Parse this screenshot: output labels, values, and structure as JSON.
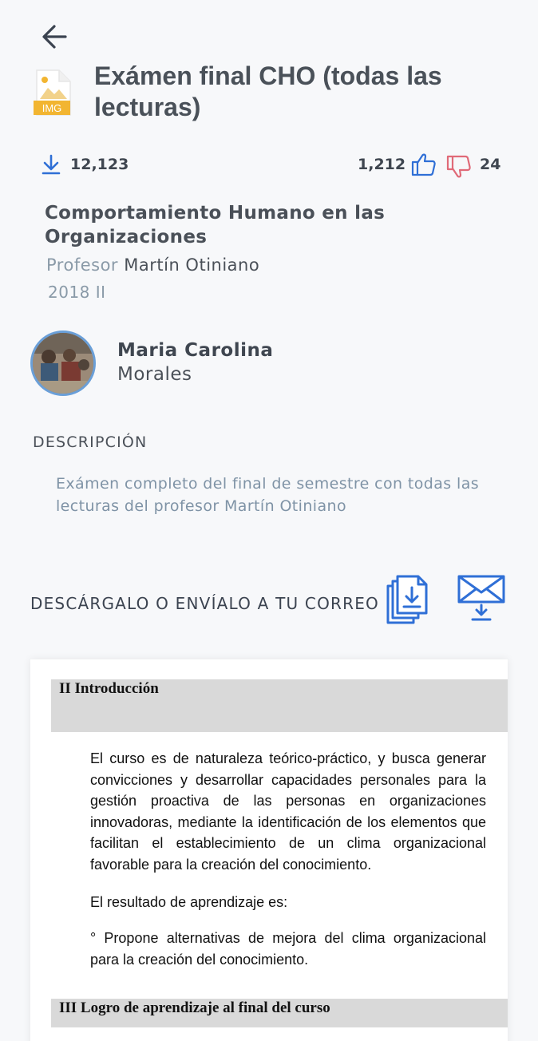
{
  "header": {
    "title": "Exámen final CHO (todas las lecturas)",
    "file_type": "IMG"
  },
  "stats": {
    "downloads": "12,123",
    "likes": "1,212",
    "dislikes": "24"
  },
  "course": {
    "name": "Comportamiento Humano en las Organizaciones",
    "professor_label": "Profesor",
    "professor_name": "Martín Otiniano",
    "term": "2018 II"
  },
  "author": {
    "first_name": "Maria Carolina",
    "last_name": "Morales"
  },
  "description": {
    "heading": "DESCRIPCIÓN",
    "text": "Exámen completo del final de semestre con todas las lecturas del profesor Martín Otiniano"
  },
  "actions": {
    "label": "DESCÁRGALO O ENVÍALO A TU CORREO",
    "download_icon": "document-download-icon",
    "email_icon": "email-download-icon"
  },
  "preview": {
    "section1_title": "II  Introducción",
    "paragraph1": "El curso es de naturaleza teórico-práctico, y busca generar convicciones y desarrollar capacidades personales para la gestión proactiva de las personas en organizaciones innovadoras, mediante la identificación de los elementos que facilitan el establecimiento de un clima organizacional favorable para la creación del conocimiento.",
    "paragraph2": "El resultado de aprendizaje es:",
    "paragraph3": "° Propone alternativas de mejora del clima organizacional para la creación del conocimiento.",
    "section2_title": "III   Logro de aprendizaje al final del curso"
  },
  "colors": {
    "accent_blue": "#2f6fd6",
    "dislike_red": "#e06a78",
    "file_icon_yellow": "#f2b531"
  }
}
